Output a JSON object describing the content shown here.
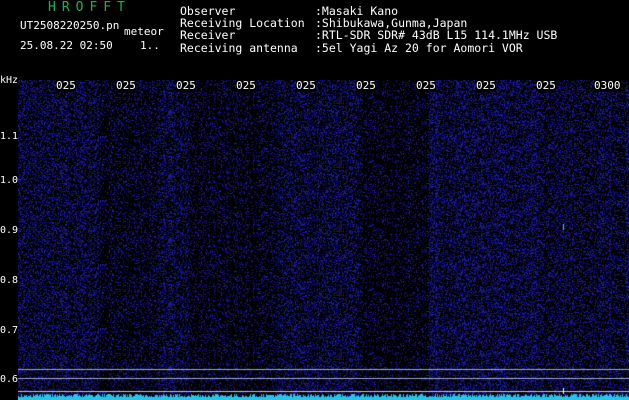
{
  "brand": "HROFFT",
  "file_name": "UT2508220250.pn",
  "meteor_label": "meteor",
  "datetime": "25.08.22 02:50",
  "count": "1..",
  "info": [
    {
      "key": "Observer",
      "value": ":Masaki Kano"
    },
    {
      "key": "Receiving Location",
      "value": ":Shibukawa,Gunma,Japan"
    },
    {
      "key": "Receiver",
      "value": ":RTL-SDR SDR# 43dB L15 114.1MHz USB"
    },
    {
      "key": "Receiving antenna",
      "value": ":5el Yagi Az 20 for Aomori VOR"
    }
  ],
  "y_axis": {
    "unit": "kHz",
    "ticks": [
      "1.1",
      "1.0",
      "0.9",
      "0.8",
      "0.7",
      "0.6"
    ]
  },
  "x_axis": {
    "ticks": [
      "025",
      "025",
      "025",
      "025",
      "025",
      "025",
      "025",
      "025",
      "025",
      "0300"
    ]
  },
  "colors": {
    "background": "#000000",
    "noise": "#1b1ba8",
    "trace": "#27c4e6",
    "brand": "#1db34a"
  }
}
